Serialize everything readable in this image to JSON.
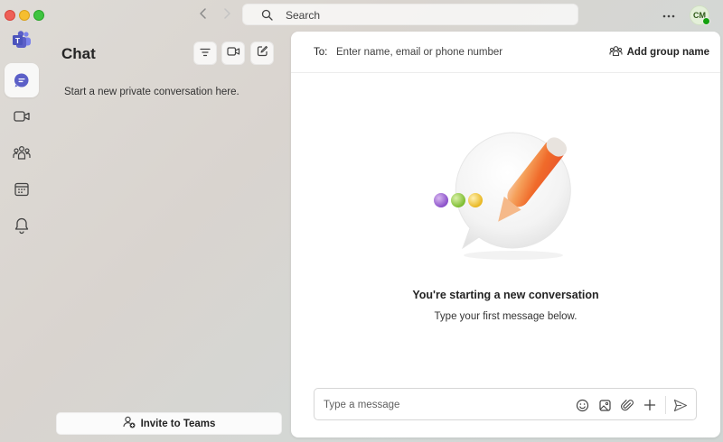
{
  "titlebar": {
    "search_placeholder": "Search",
    "avatar_initials": "CM"
  },
  "rail": {
    "items": [
      {
        "icon": "teams-logo-icon"
      },
      {
        "icon": "chat-icon",
        "active": true
      },
      {
        "icon": "video-icon"
      },
      {
        "icon": "people-icon"
      },
      {
        "icon": "calendar-icon"
      },
      {
        "icon": "bell-icon"
      }
    ]
  },
  "chat_panel": {
    "title": "Chat",
    "empty_hint": "Start a new private conversation here.",
    "invite_label": "Invite to Teams"
  },
  "main": {
    "to_label": "To:",
    "to_placeholder": "Enter name, email or phone number",
    "add_group_label": "Add group name",
    "start_title": "You're starting a new conversation",
    "start_subtitle": "Type your first message below.",
    "composer_placeholder": "Type a message"
  },
  "colors": {
    "accent": "#5b5fc7",
    "presence": "#13a10e"
  }
}
